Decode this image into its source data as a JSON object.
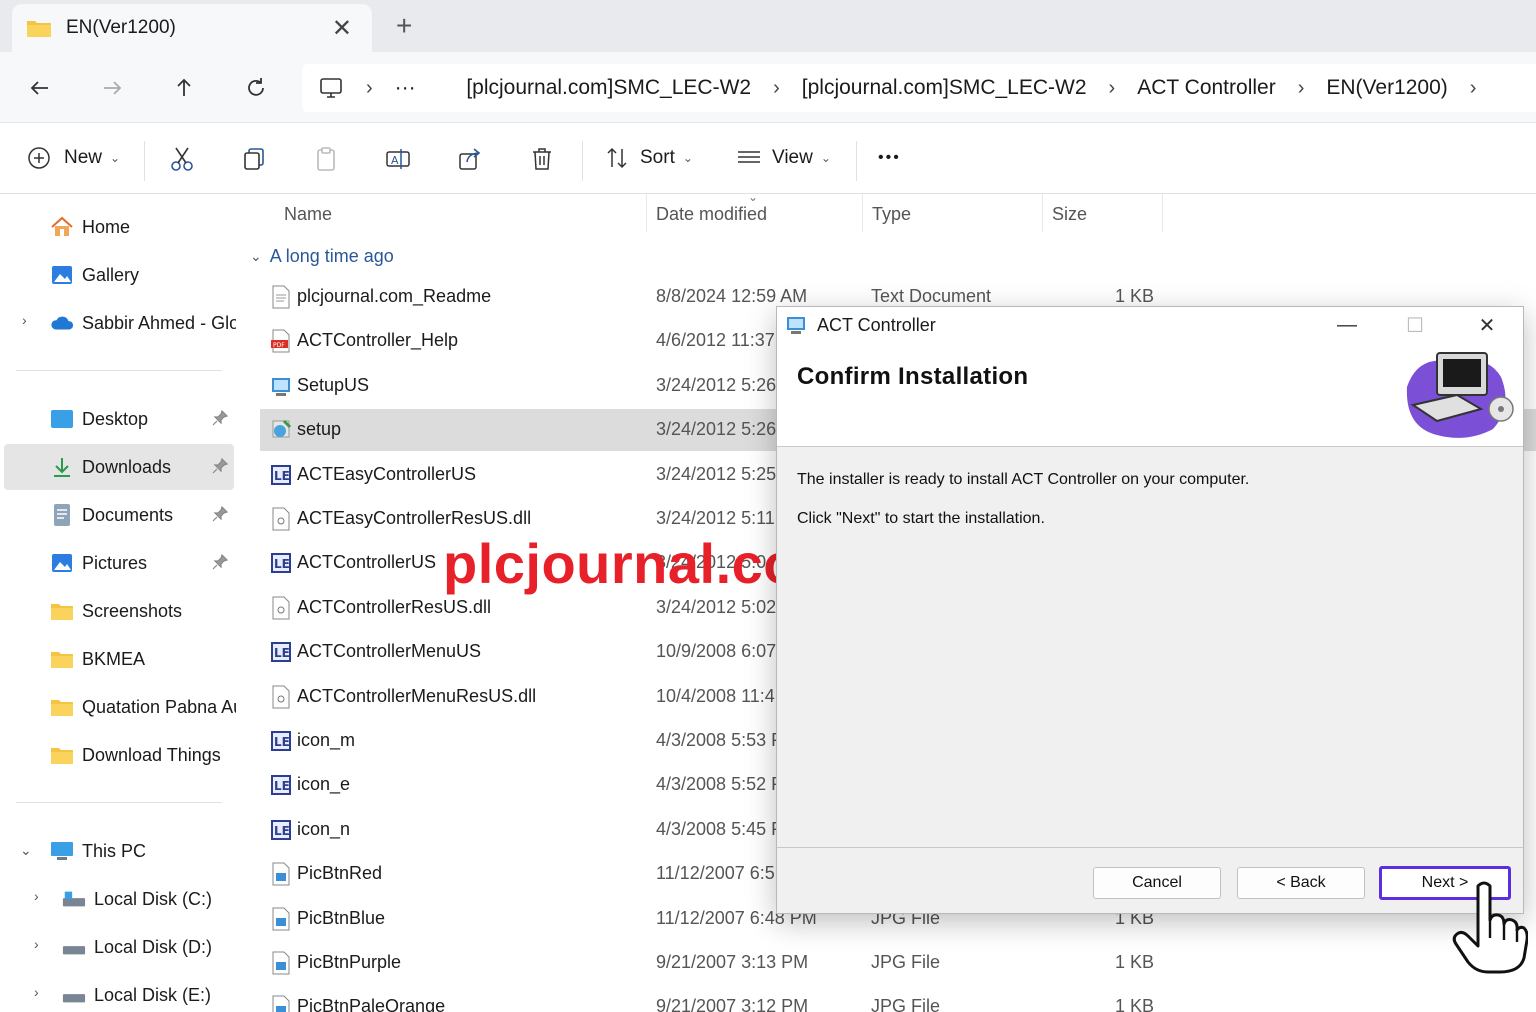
{
  "tab": {
    "title": "EN(Ver1200)",
    "close": "✕",
    "new_tab": "+"
  },
  "address": {
    "overflow": "···",
    "crumbs": [
      "[plcjournal.com]SMC_LEC-W2",
      "[plcjournal.com]SMC_LEC-W2",
      "ACT Controller",
      "EN(Ver1200)"
    ]
  },
  "toolbar": {
    "new_label": "New",
    "sort_label": "Sort",
    "view_label": "View",
    "more": "•••"
  },
  "sidebar": {
    "home": "Home",
    "gallery": "Gallery",
    "onedrive": "Sabbir Ahmed - Glo",
    "desktop": "Desktop",
    "downloads": "Downloads",
    "documents": "Documents",
    "pictures": "Pictures",
    "screenshots": "Screenshots",
    "bkmea": "BKMEA",
    "quotation": "Quatation Pabna Au",
    "download_things": "Download Things",
    "this_pc": "This PC",
    "disk_c": "Local Disk (C:)",
    "disk_d": "Local Disk (D:)",
    "disk_e": "Local Disk (E:)"
  },
  "columns": {
    "name": "Name",
    "date": "Date modified",
    "type": "Type",
    "size": "Size"
  },
  "group_label": "A long time ago",
  "files": [
    {
      "name": "plcjournal.com_Readme",
      "date": "8/8/2024 12:59 AM",
      "type": "Text Document",
      "size": "1 KB"
    },
    {
      "name": "ACTController_Help",
      "date": "4/6/2012 11:37",
      "type": "",
      "size": ""
    },
    {
      "name": "SetupUS",
      "date": "3/24/2012 5:26",
      "type": "",
      "size": ""
    },
    {
      "name": "setup",
      "date": "3/24/2012 5:26",
      "type": "",
      "size": ""
    },
    {
      "name": "ACTEasyControllerUS",
      "date": "3/24/2012 5:25",
      "type": "",
      "size": ""
    },
    {
      "name": "ACTEasyControllerResUS.dll",
      "date": "3/24/2012 5:11",
      "type": "",
      "size": ""
    },
    {
      "name": "ACTControllerUS",
      "date": "3/24/2012 5:0",
      "type": "",
      "size": ""
    },
    {
      "name": "ACTControllerResUS.dll",
      "date": "3/24/2012 5:02",
      "type": "",
      "size": ""
    },
    {
      "name": "ACTControllerMenuUS",
      "date": "10/9/2008 6:07",
      "type": "",
      "size": ""
    },
    {
      "name": "ACTControllerMenuResUS.dll",
      "date": "10/4/2008 11:4",
      "type": "",
      "size": ""
    },
    {
      "name": "icon_m",
      "date": "4/3/2008 5:53 P",
      "type": "",
      "size": ""
    },
    {
      "name": "icon_e",
      "date": "4/3/2008 5:52 P",
      "type": "",
      "size": ""
    },
    {
      "name": "icon_n",
      "date": "4/3/2008 5:45 P",
      "type": "",
      "size": ""
    },
    {
      "name": "PicBtnRed",
      "date": "11/12/2007 6:5",
      "type": "",
      "size": ""
    },
    {
      "name": "PicBtnBlue",
      "date": "11/12/2007 6:48 PM",
      "type": "JPG File",
      "size": "1 KB"
    },
    {
      "name": "PicBtnPurple",
      "date": "9/21/2007 3:13 PM",
      "type": "JPG File",
      "size": "1 KB"
    },
    {
      "name": "PicBtnPaleOrange",
      "date": "9/21/2007 3:12 PM",
      "type": "JPG File",
      "size": "1 KB"
    }
  ],
  "watermark": "plcjournal.com",
  "dialog": {
    "title": "ACT Controller",
    "heading": "Confirm Installation",
    "line1": "The installer is ready to install ACT Controller on your computer.",
    "line2": "Click \"Next\" to start the installation.",
    "cancel": "Cancel",
    "back": "< Back",
    "next": "Next >",
    "minimize": "—",
    "maximize": "☐",
    "close": "✕"
  },
  "colors": {
    "accent_purple": "#5b2ee0",
    "watermark_red": "#e8202a",
    "selected_row": "#dcdcdc"
  }
}
